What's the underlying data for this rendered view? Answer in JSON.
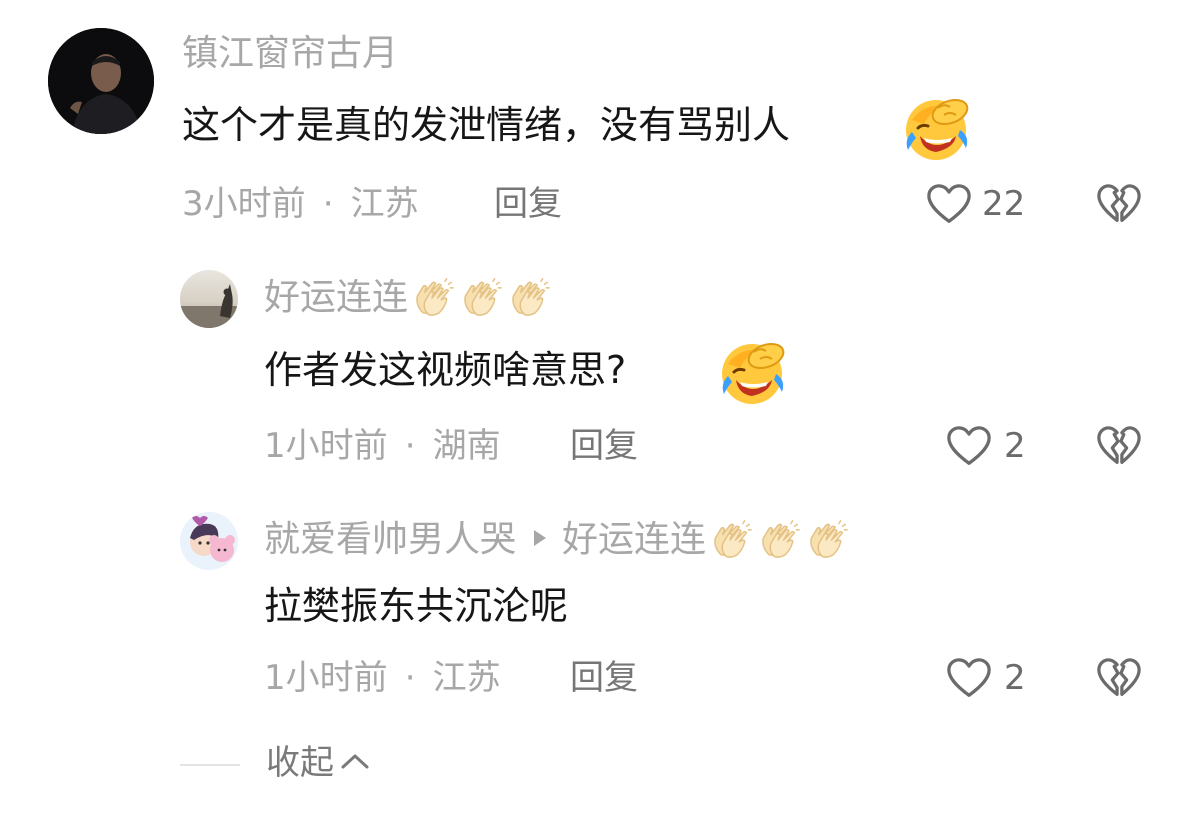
{
  "comments": [
    {
      "name": "镇江窗帘古月",
      "text": "这个才是真的发泄情绪，没有骂别人",
      "emoji": "laughing-crying-emoji",
      "time": "3小时前",
      "sep": "·",
      "location": "江苏",
      "reply": "回复",
      "likes": "22"
    },
    {
      "name": "好运连连",
      "name_emoji": "clapping-hands-emoji",
      "text": "作者发这视频啥意思?",
      "emoji": "laughing-crying-emoji",
      "time": "1小时前",
      "sep": "·",
      "location": "湖南",
      "reply": "回复",
      "likes": "2"
    },
    {
      "name": "就爱看帅男人哭",
      "reply_to": "好运连连",
      "name_emoji": "clapping-hands-emoji",
      "text": "拉樊振东共沉沦呢",
      "time": "1小时前",
      "sep": "·",
      "location": "江苏",
      "reply": "回复",
      "likes": "2"
    }
  ],
  "collapse": {
    "label": "收起"
  },
  "colors": {
    "name": "#a7a7a7",
    "text": "#161616",
    "icon": "#6b6b6b"
  }
}
